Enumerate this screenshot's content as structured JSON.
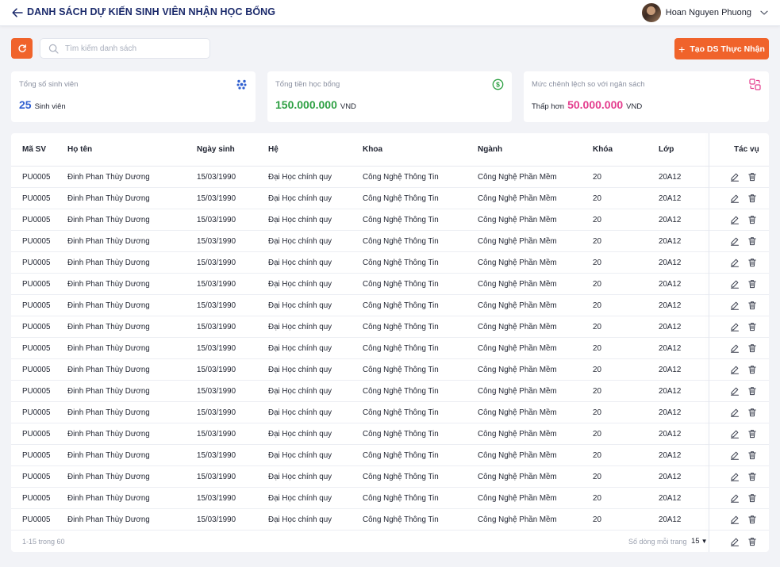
{
  "header": {
    "title": "DANH SÁCH DỰ KIẾN SINH VIÊN NHẬN HỌC BỔNG",
    "user_name": "Hoan Nguyen Phuong",
    "icons": [
      "arrow-left-icon",
      "chevron-down-icon"
    ]
  },
  "toolbar": {
    "search_placeholder": "Tìm kiếm danh sách",
    "search_value": "",
    "create_label": "Tạo DS Thực Nhận",
    "create_icon": "plus-icon",
    "refresh_icon": "refresh-icon"
  },
  "colors": {
    "accent": "#f0632b",
    "title": "#1b2a6b",
    "blue": "#2f5fd0",
    "green": "#2ea043",
    "pink": "#e43d8e"
  },
  "stats": {
    "students": {
      "label": "Tổng số sinh viên",
      "value": "25",
      "unit": "Sinh viên",
      "icon": "dots-cluster-icon"
    },
    "total": {
      "label": "Tổng tiền học bổng",
      "value": "150.000.000",
      "unit": "VND",
      "icon": "dollar-circle-icon"
    },
    "diff": {
      "label": "Mức chênh lệch so với ngân sách",
      "prefix": "Thấp hơn",
      "value": "50.000.000",
      "unit": "VND",
      "icon": "exchange-icon"
    }
  },
  "table": {
    "columns": {
      "ma_sv": "Mã SV",
      "ho_ten": "Họ tên",
      "ngay_sinh": "Ngày sinh",
      "he": "Hệ",
      "khoa": "Khoa",
      "nganh": "Ngành",
      "khoa_hoc": "Khóa",
      "lop": "Lớp",
      "tac_vu": "Tác vụ"
    },
    "rows": [
      {
        "ma_sv": "PU0005",
        "ho_ten": "Đinh Phan Thùy Dương",
        "ngay_sinh": "15/03/1990",
        "he": "Đại Học chính quy",
        "khoa": "Công Nghệ Thông Tin",
        "nganh": "Công Nghệ Phần Mềm",
        "khoa_hoc": "20",
        "lop": "20A12"
      },
      {
        "ma_sv": "PU0005",
        "ho_ten": "Đinh Phan Thùy Dương",
        "ngay_sinh": "15/03/1990",
        "he": "Đại Học chính quy",
        "khoa": "Công Nghệ Thông Tin",
        "nganh": "Công Nghệ Phần Mềm",
        "khoa_hoc": "20",
        "lop": "20A12"
      },
      {
        "ma_sv": "PU0005",
        "ho_ten": "Đinh Phan Thùy Dương",
        "ngay_sinh": "15/03/1990",
        "he": "Đại Học chính quy",
        "khoa": "Công Nghệ Thông Tin",
        "nganh": "Công Nghệ Phần Mềm",
        "khoa_hoc": "20",
        "lop": "20A12"
      },
      {
        "ma_sv": "PU0005",
        "ho_ten": "Đinh Phan Thùy Dương",
        "ngay_sinh": "15/03/1990",
        "he": "Đại Học chính quy",
        "khoa": "Công Nghệ Thông Tin",
        "nganh": "Công Nghệ Phần Mềm",
        "khoa_hoc": "20",
        "lop": "20A12"
      },
      {
        "ma_sv": "PU0005",
        "ho_ten": "Đinh Phan Thùy Dương",
        "ngay_sinh": "15/03/1990",
        "he": "Đại Học chính quy",
        "khoa": "Công Nghệ Thông Tin",
        "nganh": "Công Nghệ Phần Mềm",
        "khoa_hoc": "20",
        "lop": "20A12"
      },
      {
        "ma_sv": "PU0005",
        "ho_ten": "Đinh Phan Thùy Dương",
        "ngay_sinh": "15/03/1990",
        "he": "Đại Học chính quy",
        "khoa": "Công Nghệ Thông Tin",
        "nganh": "Công Nghệ Phần Mềm",
        "khoa_hoc": "20",
        "lop": "20A12"
      },
      {
        "ma_sv": "PU0005",
        "ho_ten": "Đinh Phan Thùy Dương",
        "ngay_sinh": "15/03/1990",
        "he": "Đại Học chính quy",
        "khoa": "Công Nghệ Thông Tin",
        "nganh": "Công Nghệ Phần Mềm",
        "khoa_hoc": "20",
        "lop": "20A12"
      },
      {
        "ma_sv": "PU0005",
        "ho_ten": "Đinh Phan Thùy Dương",
        "ngay_sinh": "15/03/1990",
        "he": "Đại Học chính quy",
        "khoa": "Công Nghệ Thông Tin",
        "nganh": "Công Nghệ Phần Mềm",
        "khoa_hoc": "20",
        "lop": "20A12"
      },
      {
        "ma_sv": "PU0005",
        "ho_ten": "Đinh Phan Thùy Dương",
        "ngay_sinh": "15/03/1990",
        "he": "Đại Học chính quy",
        "khoa": "Công Nghệ Thông Tin",
        "nganh": "Công Nghệ Phần Mềm",
        "khoa_hoc": "20",
        "lop": "20A12"
      },
      {
        "ma_sv": "PU0005",
        "ho_ten": "Đinh Phan Thùy Dương",
        "ngay_sinh": "15/03/1990",
        "he": "Đại Học chính quy",
        "khoa": "Công Nghệ Thông Tin",
        "nganh": "Công Nghệ Phần Mềm",
        "khoa_hoc": "20",
        "lop": "20A12"
      },
      {
        "ma_sv": "PU0005",
        "ho_ten": "Đinh Phan Thùy Dương",
        "ngay_sinh": "15/03/1990",
        "he": "Đại Học chính quy",
        "khoa": "Công Nghệ Thông Tin",
        "nganh": "Công Nghệ Phần Mềm",
        "khoa_hoc": "20",
        "lop": "20A12"
      },
      {
        "ma_sv": "PU0005",
        "ho_ten": "Đinh Phan Thùy Dương",
        "ngay_sinh": "15/03/1990",
        "he": "Đại Học chính quy",
        "khoa": "Công Nghệ Thông Tin",
        "nganh": "Công Nghệ Phần Mềm",
        "khoa_hoc": "20",
        "lop": "20A12"
      },
      {
        "ma_sv": "PU0005",
        "ho_ten": "Đinh Phan Thùy Dương",
        "ngay_sinh": "15/03/1990",
        "he": "Đại Học chính quy",
        "khoa": "Công Nghệ Thông Tin",
        "nganh": "Công Nghệ Phần Mềm",
        "khoa_hoc": "20",
        "lop": "20A12"
      },
      {
        "ma_sv": "PU0005",
        "ho_ten": "Đinh Phan Thùy Dương",
        "ngay_sinh": "15/03/1990",
        "he": "Đại Học chính quy",
        "khoa": "Công Nghệ Thông Tin",
        "nganh": "Công Nghệ Phần Mềm",
        "khoa_hoc": "20",
        "lop": "20A12"
      },
      {
        "ma_sv": "PU0005",
        "ho_ten": "Đinh Phan Thùy Dương",
        "ngay_sinh": "15/03/1990",
        "he": "Đại Học chính quy",
        "khoa": "Công Nghệ Thông Tin",
        "nganh": "Công Nghệ Phần Mềm",
        "khoa_hoc": "20",
        "lop": "20A12"
      },
      {
        "ma_sv": "PU0005",
        "ho_ten": "Đinh Phan Thùy Dương",
        "ngay_sinh": "15/03/1990",
        "he": "Đại Học chính quy",
        "khoa": "Công Nghệ Thông Tin",
        "nganh": "Công Nghệ Phần Mềm",
        "khoa_hoc": "20",
        "lop": "20A12"
      },
      {
        "ma_sv": "PU0005",
        "ho_ten": "Đinh Phan Thùy Dương",
        "ngay_sinh": "15/03/1990",
        "he": "Đại Học chính quy",
        "khoa": "Công Nghệ Thông Tin",
        "nganh": "Công Nghệ Phần Mềm",
        "khoa_hoc": "20",
        "lop": "20A12"
      }
    ],
    "row_action_icons": [
      "edit-icon",
      "trash-icon"
    ]
  },
  "pagination": {
    "range": "1-15 trong 60",
    "per_page_label": "Số dòng mỗi trang",
    "per_page_value": "15"
  }
}
